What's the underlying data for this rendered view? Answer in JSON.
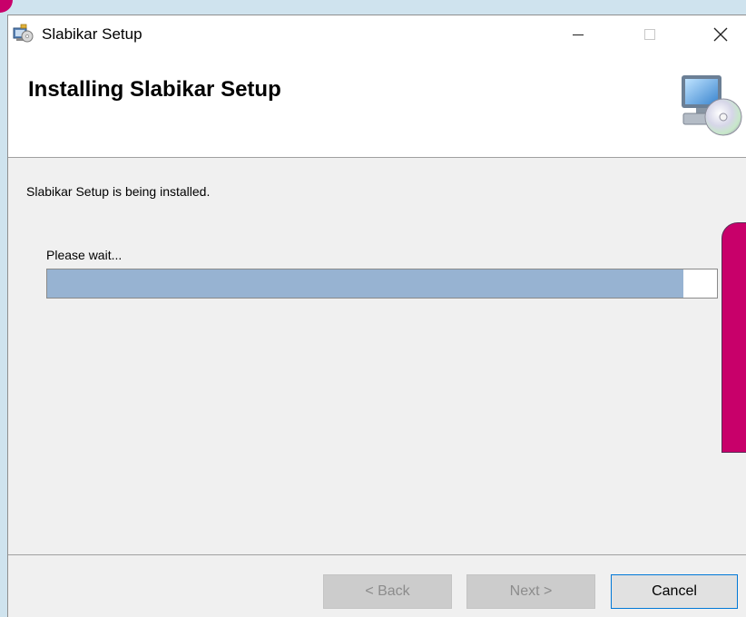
{
  "window": {
    "title": "Slabikar Setup",
    "icon": "installer-icon",
    "controls": {
      "minimize": "minimize-icon",
      "maximize": "maximize-icon",
      "close": "close-icon"
    }
  },
  "header": {
    "title": "Installing Slabikar Setup",
    "graphic": "computer-disc-icon"
  },
  "body": {
    "status": "Slabikar Setup is being installed.",
    "wait_label": "Please wait...",
    "progress_fraction": 0.95
  },
  "buttons": {
    "back": "< Back",
    "next": "Next >",
    "cancel": "Cancel"
  },
  "colors": {
    "progress_fill": "#97b3d2",
    "overlay_accent": "#c8006a"
  }
}
